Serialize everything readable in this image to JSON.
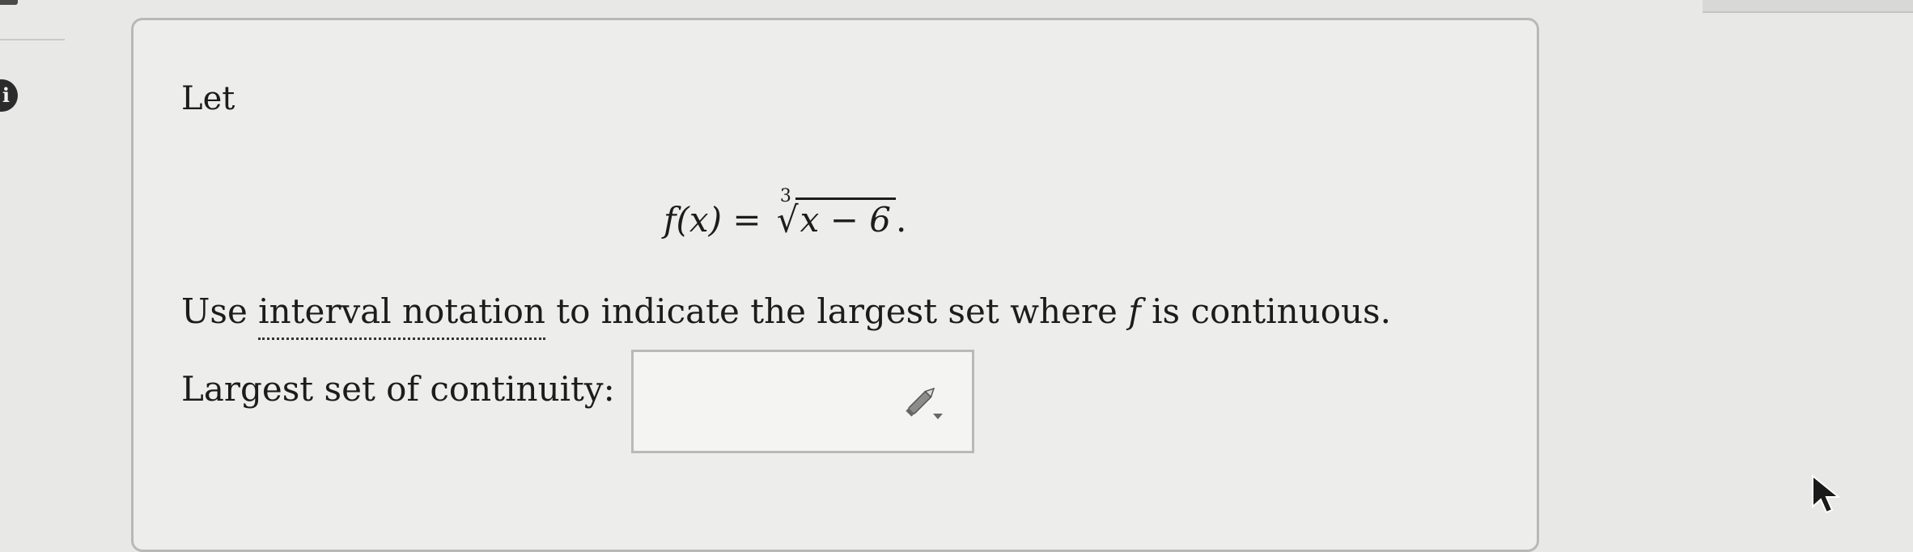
{
  "question": {
    "let_label": "Let",
    "formula": {
      "lhs": "f(x) =",
      "root_index": "3",
      "radicand": "x − 6",
      "period": "."
    },
    "instruction": {
      "part1": "Use ",
      "link": "interval notation",
      "part2": " to indicate the largest set where ",
      "var": "f",
      "part3": " is continuous."
    },
    "answer_label": "Largest set of continuity:",
    "answer_value": ""
  }
}
